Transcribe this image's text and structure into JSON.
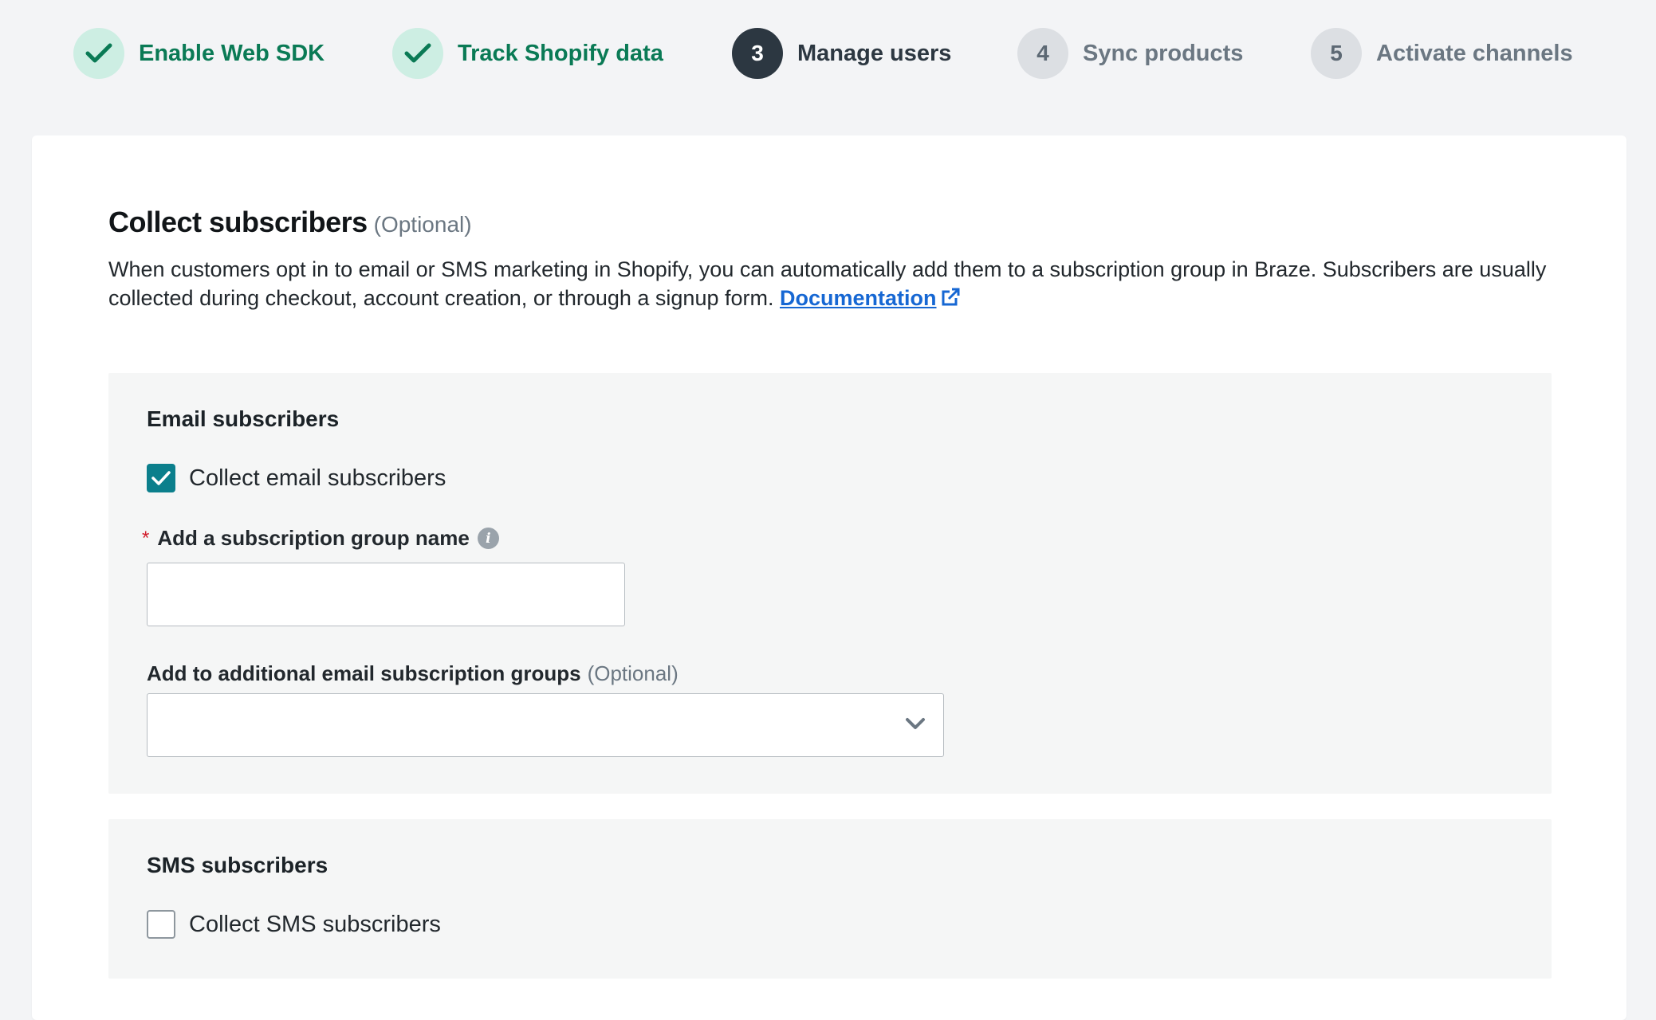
{
  "stepper": {
    "steps": [
      {
        "number": "",
        "label": "Enable Web SDK",
        "state": "done",
        "icon": "check-icon"
      },
      {
        "number": "",
        "label": "Track Shopify data",
        "state": "done",
        "icon": "check-icon"
      },
      {
        "number": "3",
        "label": "Manage users",
        "state": "current"
      },
      {
        "number": "4",
        "label": "Sync products",
        "state": "todo"
      },
      {
        "number": "5",
        "label": "Activate channels",
        "state": "todo"
      }
    ]
  },
  "main": {
    "title": "Collect subscribers",
    "title_optional": "(Optional)",
    "description": "When customers opt in to email or SMS marketing in Shopify, you can automatically add them to a subscription group in Braze. Subscribers are usually collected during checkout, account creation, or through a signup form.",
    "doc_link": "Documentation",
    "doc_link_icon": "external-link-icon"
  },
  "email_section": {
    "title": "Email subscribers",
    "checkbox_label": "Collect email subscribers",
    "checkbox_checked": true,
    "group_name_label": "Add a subscription group name",
    "required_marker": "*",
    "group_name_value": "",
    "additional_groups_label": "Add to additional email subscription groups",
    "additional_groups_optional": "(Optional)",
    "additional_groups_value": ""
  },
  "sms_section": {
    "title": "SMS subscribers",
    "checkbox_label": "Collect SMS subscribers",
    "checkbox_checked": false
  },
  "colors": {
    "done_green": "#0a7a55",
    "done_circle_bg": "#cdeee3",
    "current_circle_bg": "#2c3741",
    "checkbox_teal": "#0b7f8c",
    "link_blue": "#1667d3",
    "required_red": "#d11c2a"
  }
}
